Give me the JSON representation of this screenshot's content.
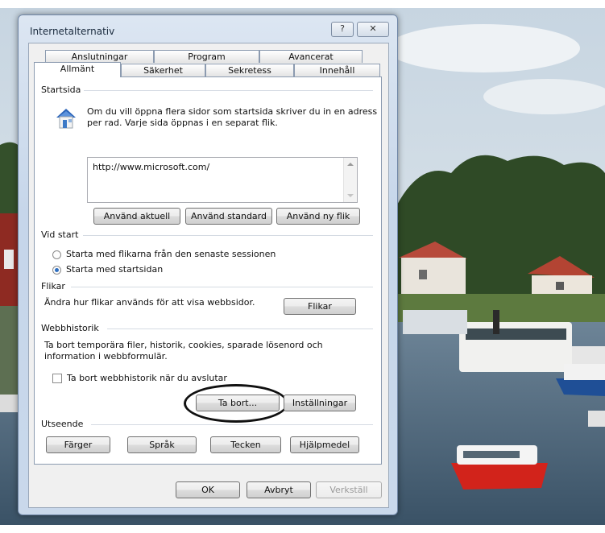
{
  "window": {
    "title": "Internetalternativ",
    "help_label": "?",
    "close_label": "✕"
  },
  "tabs": {
    "row1": [
      "Anslutningar",
      "Program",
      "Avancerat"
    ],
    "row2": [
      "Allmänt",
      "Säkerhet",
      "Sekretess",
      "Innehåll"
    ],
    "active": "Allmänt"
  },
  "home": {
    "group_title": "Startsida",
    "description_line1": "Om du vill öppna flera sidor som startsida skriver du in en adress",
    "description_line2": "per rad. Varje sida öppnas i en separat flik.",
    "url": "http://www.microsoft.com/",
    "use_current": "Använd aktuell",
    "use_default": "Använd standard",
    "use_new_tab": "Använd ny flik"
  },
  "startup": {
    "group_title": "Vid start",
    "option_last_session": "Starta med flikarna från den senaste sessionen",
    "option_home": "Starta med startsidan",
    "selected": "home"
  },
  "tabs_group": {
    "group_title": "Flikar",
    "description": "Ändra hur flikar används för att visa webbsidor.",
    "button": "Flikar"
  },
  "history": {
    "group_title": "Webbhistorik",
    "description_line1": "Ta bort temporära filer, historik, cookies, sparade lösenord och",
    "description_line2": "information i webbformulär.",
    "checkbox_label": "Ta bort webbhistorik när du avslutar",
    "checked": false,
    "delete_button": "Ta bort...",
    "settings_button": "Inställningar"
  },
  "appearance": {
    "group_title": "Utseende",
    "colors": "Färger",
    "languages": "Språk",
    "fonts": "Tecken",
    "accessibility": "Hjälpmedel"
  },
  "footer": {
    "ok": "OK",
    "cancel": "Avbryt",
    "apply": "Verkställ"
  },
  "colors": {
    "accent": "#2d6ec0",
    "highlight_ring": "#111111"
  }
}
